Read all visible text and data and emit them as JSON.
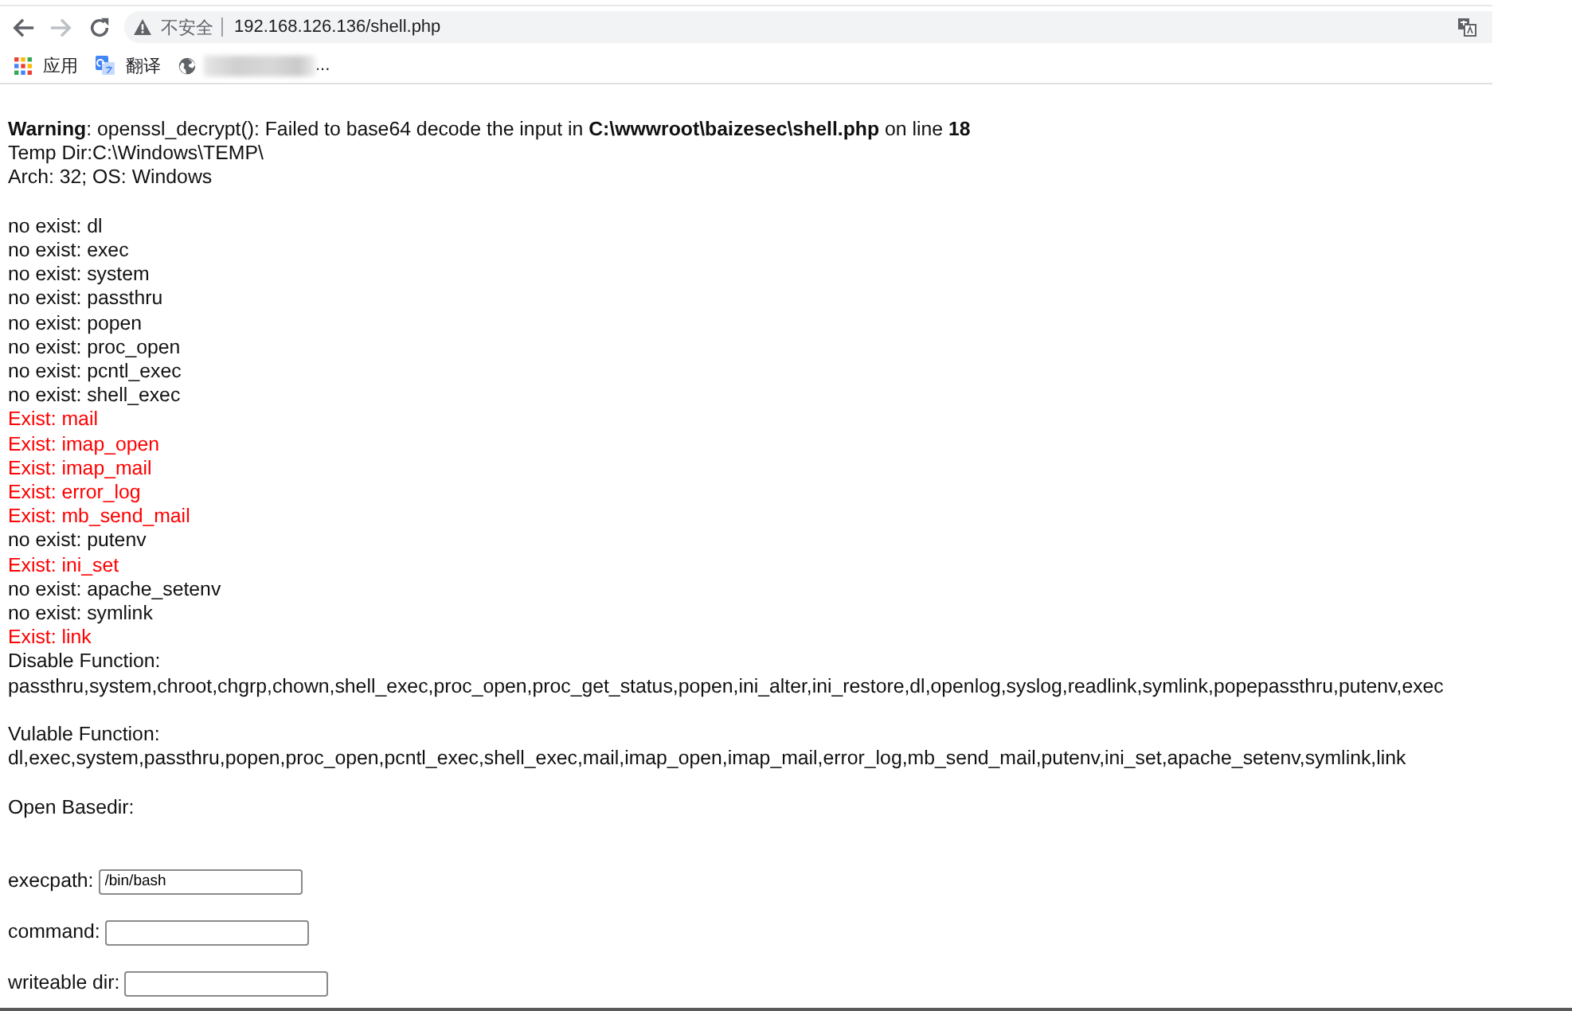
{
  "browser": {
    "navigation": [
      {
        "kind": "back",
        "disabled": false
      },
      {
        "kind": "forward",
        "disabled": true
      },
      {
        "kind": "reload",
        "disabled": false
      }
    ],
    "address_bar": {
      "security_label": "不安全",
      "url": "192.168.126.136/shell.php"
    },
    "bookmarks": [
      {
        "kind": "apps",
        "label": "应用"
      },
      {
        "kind": "translate",
        "label": "翻译"
      },
      {
        "kind": "site",
        "label": "..."
      }
    ]
  },
  "page": {
    "warning": "**Warning**: openssl_decrypt(): Failed to base64 decode the input in **C:\\wwwroot\\baizesec\\shell.php** on line **18**",
    "info_lines": [
      "Temp Dir:C:\\Windows\\TEMP\\",
      "Arch: 32; OS: Windows"
    ],
    "function_checks": [
      {
        "text": "no exist: dl",
        "exists": false
      },
      {
        "text": "no exist: exec",
        "exists": false
      },
      {
        "text": "no exist: system",
        "exists": false
      },
      {
        "text": "no exist: passthru",
        "exists": false
      },
      {
        "text": "no exist: popen",
        "exists": false
      },
      {
        "text": "no exist: proc_open",
        "exists": false
      },
      {
        "text": "no exist: pcntl_exec",
        "exists": false
      },
      {
        "text": "no exist: shell_exec",
        "exists": false
      },
      {
        "text": "Exist: mail",
        "exists": true
      },
      {
        "text": "Exist: imap_open",
        "exists": true
      },
      {
        "text": "Exist: imap_mail",
        "exists": true
      },
      {
        "text": "Exist: error_log",
        "exists": true
      },
      {
        "text": "Exist: mb_send_mail",
        "exists": true
      },
      {
        "text": "no exist: putenv",
        "exists": false
      },
      {
        "text": "Exist: ini_set",
        "exists": true
      },
      {
        "text": "no exist: apache_setenv",
        "exists": false
      },
      {
        "text": "no exist: symlink",
        "exists": false
      },
      {
        "text": "Exist: link",
        "exists": true
      }
    ],
    "disable_functions": {
      "label": "Disable Function:",
      "value": "passthru,system,chroot,chgrp,chown,shell_exec,proc_open,proc_get_status,popen,ini_alter,ini_restore,dl,openlog,syslog,readlink,symlink,popepassthru,putenv,exec"
    },
    "vulable_functions": {
      "label": "Vulable Function:",
      "value": "dl,exec,system,passthru,popen,proc_open,pcntl_exec,shell_exec,mail,imap_open,imap_mail,error_log,mb_send_mail,putenv,ini_set,apache_setenv,symlink,link"
    },
    "open_basedir": {
      "label": "Open Basedir:"
    },
    "form_fields": [
      {
        "label": "execpath:",
        "value": "/bin/bash"
      },
      {
        "label": "command:"
      },
      {
        "label": "writeable dir:"
      }
    ]
  }
}
